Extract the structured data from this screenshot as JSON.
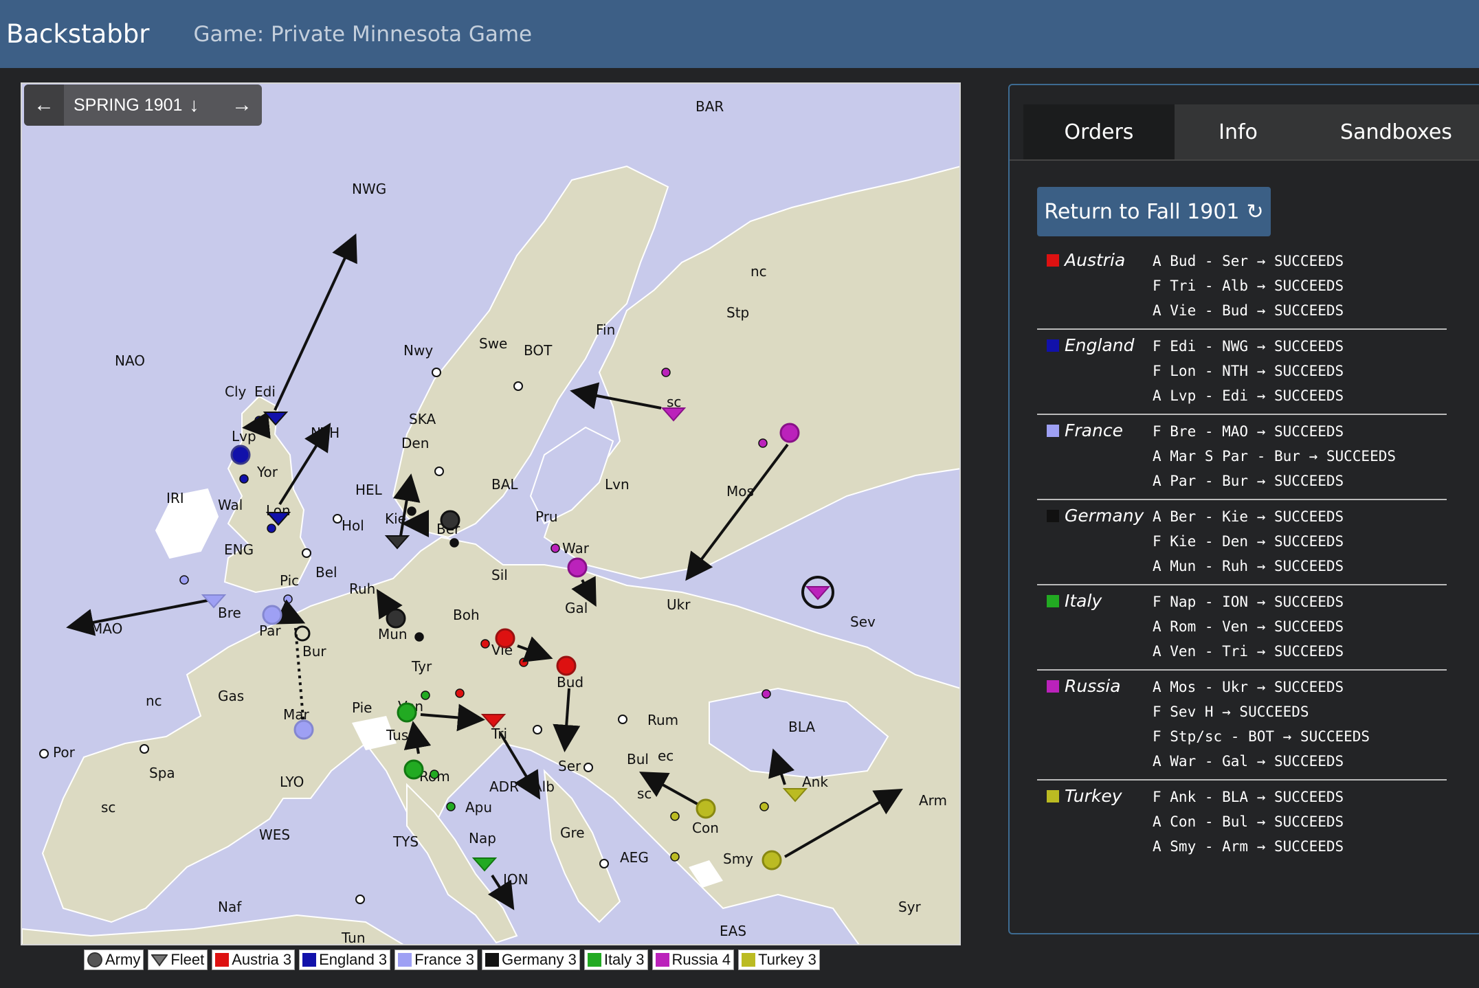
{
  "header": {
    "brand": "Backstabbr",
    "game_title": "Game: Private Minnesota Game"
  },
  "turn": {
    "label": "SPRING 1901",
    "prev_icon": "arrow-left-icon",
    "next_icon": "arrow-right-icon",
    "download_icon": "arrow-down-icon"
  },
  "tabs": [
    {
      "label": "Orders"
    },
    {
      "label": "Info"
    },
    {
      "label": "Sandboxes"
    }
  ],
  "return_button": {
    "label": "Return to Fall 1901",
    "icon": "refresh-icon"
  },
  "colors": {
    "austria": "#dd1111",
    "england": "#1111aa",
    "france": "#9ea0f4",
    "germany": "#111111",
    "italy": "#22aa22",
    "russia": "#bb22bb",
    "turkey": "#bbbb22",
    "sea": "#c8caeb",
    "land": "#dcdac2",
    "header": "#3d5f86"
  },
  "orders": [
    {
      "power": "Austria",
      "color": "#dd1111",
      "lines": [
        "A Bud - Ser → SUCCEEDS",
        "F Tri - Alb → SUCCEEDS",
        "A Vie - Bud → SUCCEEDS"
      ]
    },
    {
      "power": "England",
      "color": "#1111aa",
      "lines": [
        "F Edi - NWG → SUCCEEDS",
        "F Lon - NTH → SUCCEEDS",
        "A Lvp - Edi → SUCCEEDS"
      ]
    },
    {
      "power": "France",
      "color": "#9ea0f4",
      "lines": [
        "F Bre - MAO → SUCCEEDS",
        "A Mar S Par - Bur → SUCCEEDS",
        "A Par - Bur → SUCCEEDS"
      ]
    },
    {
      "power": "Germany",
      "color": "#111111",
      "lines": [
        "A Ber - Kie → SUCCEEDS",
        "F Kie - Den → SUCCEEDS",
        "A Mun - Ruh → SUCCEEDS"
      ]
    },
    {
      "power": "Italy",
      "color": "#22aa22",
      "lines": [
        "F Nap - ION → SUCCEEDS",
        "A Rom - Ven → SUCCEEDS",
        "A Ven - Tri → SUCCEEDS"
      ]
    },
    {
      "power": "Russia",
      "color": "#bb22bb",
      "lines": [
        "A Mos - Ukr → SUCCEEDS",
        "F Sev H → SUCCEEDS",
        "F Stp/sc - BOT → SUCCEEDS",
        "A War - Gal → SUCCEEDS"
      ]
    },
    {
      "power": "Turkey",
      "color": "#bbbb22",
      "lines": [
        "F Ank - BLA → SUCCEEDS",
        "A Con - Bul → SUCCEEDS",
        "A Smy - Arm → SUCCEEDS"
      ]
    }
  ],
  "legend": [
    {
      "label": "Army",
      "icon": "army-icon"
    },
    {
      "label": "Fleet",
      "icon": "fleet-icon"
    },
    {
      "label": "Austria 3",
      "color": "#dd1111"
    },
    {
      "label": "England 3",
      "color": "#1111aa"
    },
    {
      "label": "France 3",
      "color": "#9ea0f4"
    },
    {
      "label": "Germany 3",
      "color": "#111111"
    },
    {
      "label": "Italy 3",
      "color": "#22aa22"
    },
    {
      "label": "Russia 4",
      "color": "#bb22bb"
    },
    {
      "label": "Turkey 3",
      "color": "#bbbb22"
    }
  ],
  "map": {
    "labels": [
      "BAR",
      "NWG",
      "NAO",
      "nc",
      "Stp",
      "Fin",
      "BOT",
      "Swe",
      "Nwy",
      "Cly",
      "Edi",
      "NTH",
      "Lvp",
      "Yor",
      "IRI",
      "Wal",
      "Lon",
      "SKA",
      "Den",
      "HEL",
      "BAL",
      "Lvn",
      "Mos",
      "Kie",
      "Ber",
      "Pru",
      "Hol",
      "ENG",
      "Bel",
      "Pic",
      "Ruh",
      "Sil",
      "War",
      "MAO",
      "Bre",
      "Par",
      "Bur",
      "Mun",
      "Boh",
      "Vie",
      "Gal",
      "Ukr",
      "Sev",
      "Tyr",
      "Bud",
      "Gas",
      "nc",
      "Mar",
      "Pie",
      "Ven",
      "Tri",
      "Rum",
      "BLA",
      "Tus",
      "Rom",
      "Ser",
      "Bul",
      "ec",
      "Ank",
      "Arm",
      "Por",
      "Spa",
      "LYO",
      "ADR",
      "Alb",
      "Apu",
      "sc",
      "sc",
      "sc",
      "Con",
      "WES",
      "TYS",
      "Nap",
      "Gre",
      "AEG",
      "Smy",
      "ION",
      "Naf",
      "Tun",
      "EAS",
      "Syr"
    ]
  }
}
